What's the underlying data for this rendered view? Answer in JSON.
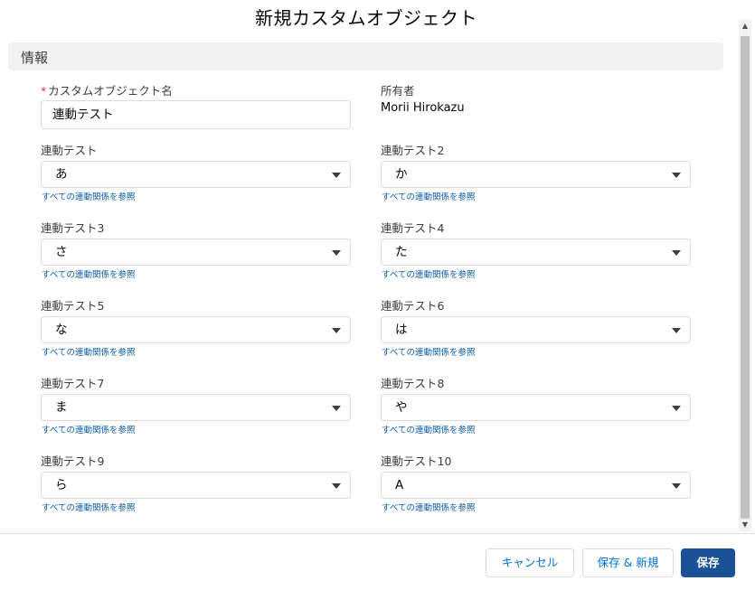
{
  "modal": {
    "title": "新規カスタムオブジェクト"
  },
  "section": {
    "title": "情報"
  },
  "name_field": {
    "required_mark": "*",
    "label": "カスタムオブジェクト名",
    "value": "連動テスト"
  },
  "owner": {
    "label": "所有者",
    "value": "Morii Hirokazu"
  },
  "lookup_link_text": "すべての連動関係を参照",
  "fields": [
    {
      "label": "連動テスト",
      "value": "あ"
    },
    {
      "label": "連動テスト2",
      "value": "か"
    },
    {
      "label": "連動テスト3",
      "value": "さ"
    },
    {
      "label": "連動テスト4",
      "value": "た"
    },
    {
      "label": "連動テスト5",
      "value": "な"
    },
    {
      "label": "連動テスト6",
      "value": "は"
    },
    {
      "label": "連動テスト7",
      "value": "ま"
    },
    {
      "label": "連動テスト8",
      "value": "や"
    },
    {
      "label": "連動テスト9",
      "value": "ら"
    },
    {
      "label": "連動テスト10",
      "value": "A"
    }
  ],
  "footer": {
    "cancel_label": "キャンセル",
    "save_new_label": "保存 & 新規",
    "save_label": "保存"
  },
  "colors": {
    "brand": "#1b5297",
    "link": "#0b5cab",
    "required": "#c23934"
  }
}
